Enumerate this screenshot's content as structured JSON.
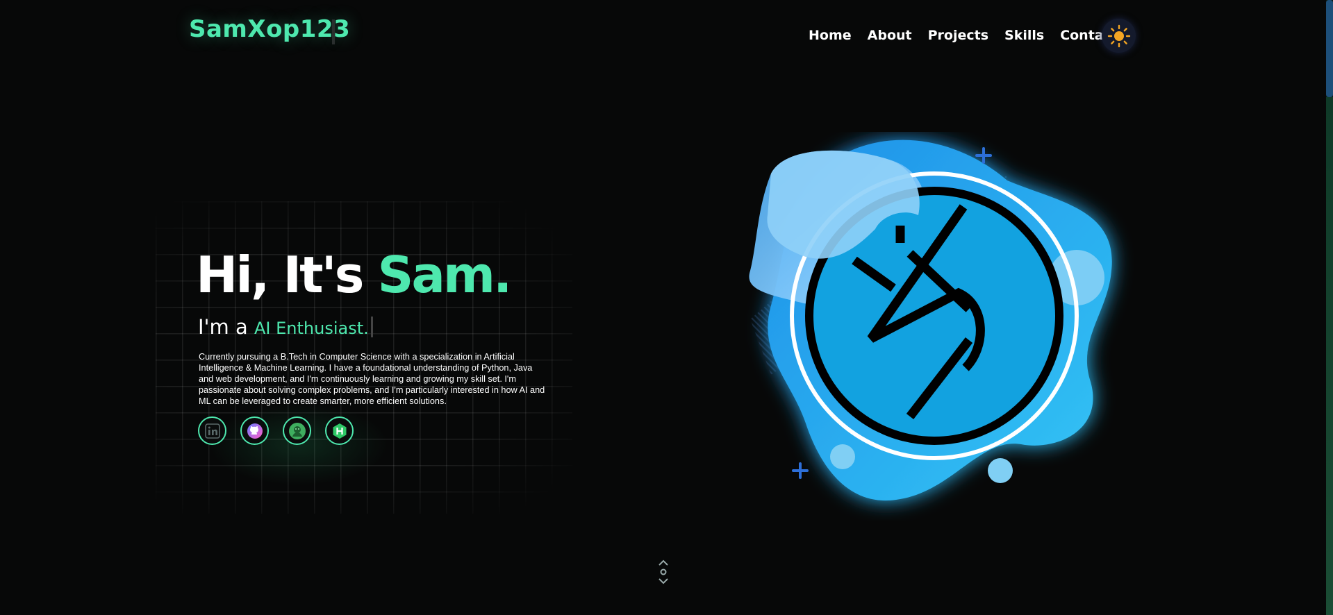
{
  "header": {
    "logo": "SamXop123",
    "nav": [
      "Home",
      "About",
      "Projects",
      "Skills",
      "Contact"
    ],
    "theme_toggle_icon": "sun-icon"
  },
  "hero": {
    "greeting": "Hi, It's ",
    "name": "Sam.",
    "role_prefix": "I'm a ",
    "role": "AI Enthusiast.",
    "bio": "Currently pursuing a B.Tech in Computer Science with a specialization in Artificial Intelligence & Machine Learning. I have a foundational understanding of Python, Java and web development, and I'm continuously learning and growing my skill set. I'm passionate about solving complex problems, and I'm particularly interested in how AI and ML can be leveraged to create smarter, more efficient solutions.",
    "socials": [
      "linkedin-icon",
      "github-icon",
      "leetcode-icon",
      "hackerrank-icon"
    ]
  },
  "colors": {
    "accent": "#4ee8ae",
    "background": "#070808",
    "avatar_blue": "#12a2e0"
  },
  "scroll_hint_icon": "scroll-down-icon"
}
